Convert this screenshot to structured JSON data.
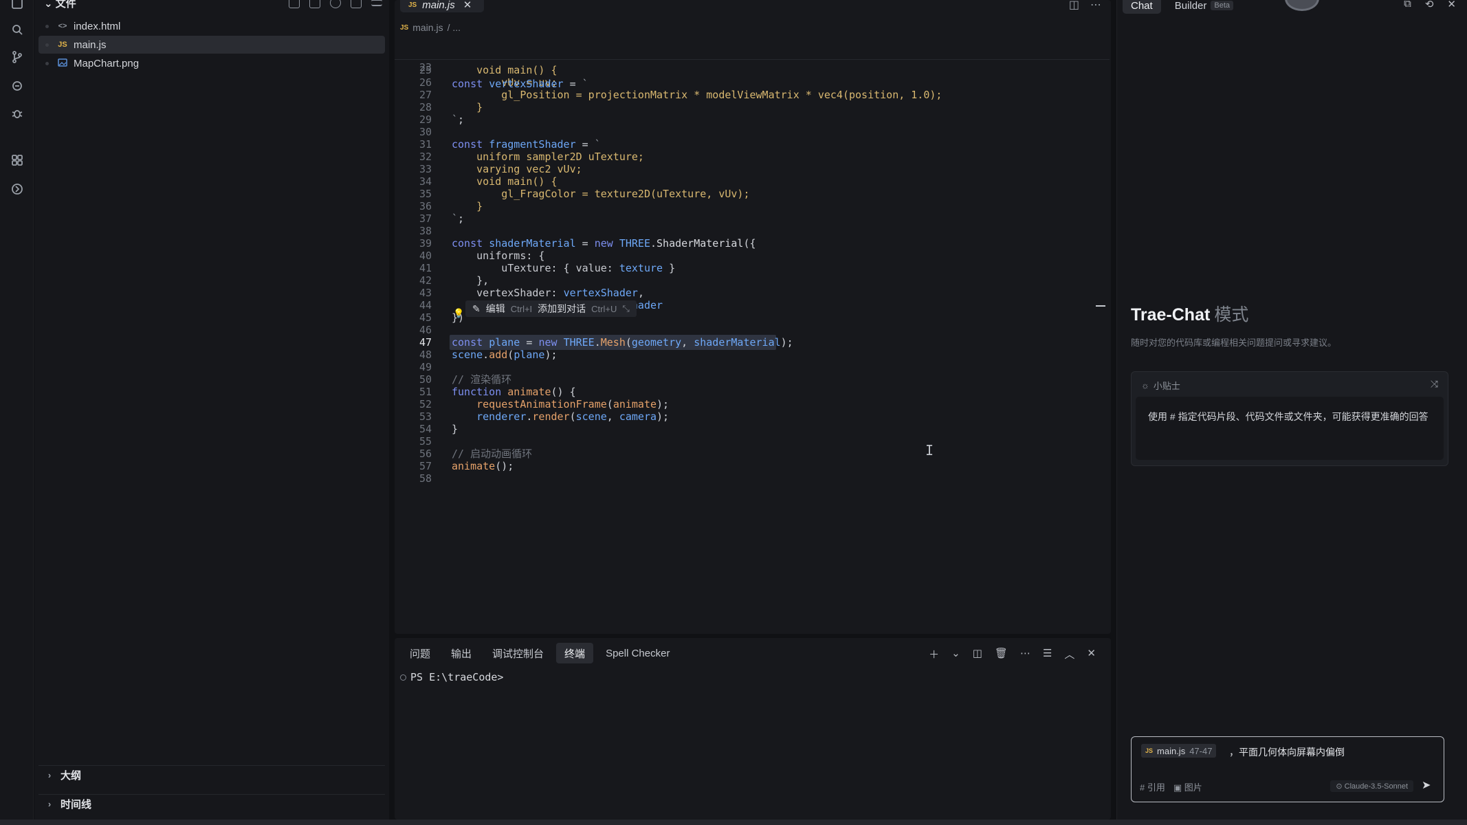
{
  "explorer": {
    "title": "文件",
    "files": [
      {
        "name": "index.html",
        "icon": "<>",
        "icon_color": "#8e939b"
      },
      {
        "name": "main.js",
        "icon": "JS",
        "icon_color": "#e2b44a",
        "selected": true
      },
      {
        "name": "MapChart.png",
        "icon": "img",
        "icon_color": "#5a8fd8"
      }
    ],
    "sections": [
      "大纲",
      "时间线"
    ]
  },
  "editor": {
    "tab_label": "main.js",
    "breadcrumb_file": "main.js",
    "breadcrumb_rest": "/ ...",
    "sticky_line_no": "23",
    "sticky_code": "const vertexShader = `",
    "current_line": "47",
    "inline_hint": {
      "edit": "编辑",
      "edit_key": "Ctrl+I",
      "add": "添加到对话",
      "add_key": "Ctrl+U"
    },
    "lines": [
      {
        "n": "25",
        "html": "    <span class='glsl'>void main() {</span>"
      },
      {
        "n": "26",
        "html": "        <span class='glsl'>vUv = uv;</span>"
      },
      {
        "n": "27",
        "html": "        <span class='glsl'>gl_Position = projectionMatrix * modelViewMatrix * vec4(position, 1.0);</span>"
      },
      {
        "n": "28",
        "html": "    <span class='glsl'>}</span>"
      },
      {
        "n": "29",
        "html": "<span class='str'>`</span>;"
      },
      {
        "n": "30",
        "html": ""
      },
      {
        "n": "31",
        "html": "<span class='kw'>const</span> <span class='blue'>fragmentShader</span> = <span class='str'>`</span>"
      },
      {
        "n": "32",
        "html": "    <span class='glsl'>uniform sampler2D uTexture;</span>"
      },
      {
        "n": "33",
        "html": "    <span class='glsl'>varying vec2 vUv;</span>"
      },
      {
        "n": "34",
        "html": "    <span class='glsl'>void main() {</span>"
      },
      {
        "n": "35",
        "html": "        <span class='glsl'>gl_FragColor = texture2D(uTexture, vUv);</span>"
      },
      {
        "n": "36",
        "html": "    <span class='glsl'>}</span>"
      },
      {
        "n": "37",
        "html": "<span class='str'>`</span>;"
      },
      {
        "n": "38",
        "html": ""
      },
      {
        "n": "39",
        "html": "<span class='kw'>const</span> <span class='blue'>shaderMaterial</span> = <span class='kw'>new</span> <span class='cls'>THREE</span>.<span class='var'>ShaderMaterial</span>({"
      },
      {
        "n": "40",
        "html": "    <span class='prop'>uniforms</span>: {"
      },
      {
        "n": "41",
        "html": "        <span class='prop'>uTexture</span>: { <span class='prop'>value</span>: <span class='blue'>texture</span> }"
      },
      {
        "n": "42",
        "html": "    },"
      },
      {
        "n": "43",
        "html": "    <span class='prop'>vertexShader</span>: <span class='blue'>vertexShader</span>,"
      },
      {
        "n": "44",
        "html": "    <span class='prop'>fragmentShader</span>: <span class='blue'>fragmentShader</span>"
      },
      {
        "n": "45",
        "html": "})"
      },
      {
        "n": "46",
        "html": ""
      },
      {
        "n": "47",
        "html": "<span class='kw'>const</span> <span class='blue'>plane</span> = <span class='kw'>new</span> <span class='cls'>THREE</span>.<span class='fn'>Mesh</span>(<span class='blue'>geometry</span>, <span class='blue'>shaderMaterial</span>);"
      },
      {
        "n": "48",
        "html": "<span class='blue'>scene</span>.<span class='fn'>add</span>(<span class='blue'>plane</span>);"
      },
      {
        "n": "49",
        "html": ""
      },
      {
        "n": "50",
        "html": "<span class='cmt'>// 渲染循环</span>"
      },
      {
        "n": "51",
        "html": "<span class='kw'>function</span> <span class='fn'>animate</span>() {"
      },
      {
        "n": "52",
        "html": "    <span class='fn'>requestAnimationFrame</span>(<span class='fn'>animate</span>);"
      },
      {
        "n": "53",
        "html": "    <span class='blue'>renderer</span>.<span class='fn'>render</span>(<span class='blue'>scene</span>, <span class='blue'>camera</span>);"
      },
      {
        "n": "54",
        "html": "}"
      },
      {
        "n": "55",
        "html": ""
      },
      {
        "n": "56",
        "html": "<span class='cmt'>// 启动动画循环</span>"
      },
      {
        "n": "57",
        "html": "<span class='fn'>animate</span>();"
      },
      {
        "n": "58",
        "html": ""
      }
    ]
  },
  "panel": {
    "tabs": [
      "问题",
      "输出",
      "调试控制台",
      "终端",
      "Spell Checker"
    ],
    "active_tab": "终端",
    "prompt": "PS E:\\traeCode>"
  },
  "chat": {
    "tabs": [
      "Chat",
      "Builder"
    ],
    "beta": "Beta",
    "title": "Trae-Chat",
    "title_mode": "模式",
    "subtitle": "随时对您的代码库或编程相关问题提问或寻求建议。",
    "tips_title": "小贴士",
    "tips_body": "使用 # 指定代码片段、代码文件或文件夹，可能获得更准确的回答",
    "ref_file": "main.js",
    "ref_range": "47-47",
    "input_text": "，平面几何体向屏幕内偏倒",
    "foot_ref": "# 引用",
    "foot_image": "图片",
    "model": "Claude-3.5-Sonnet"
  }
}
